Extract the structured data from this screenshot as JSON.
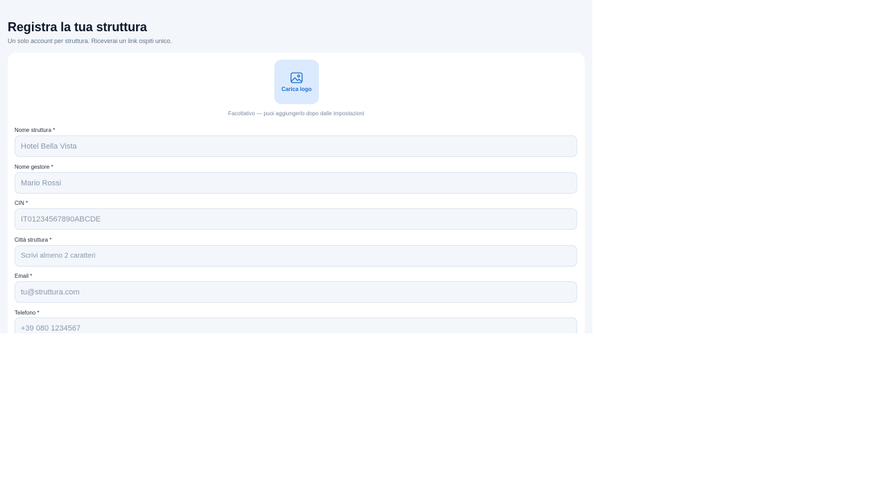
{
  "header": {
    "title": "Registra la tua struttura",
    "subtitle": "Un solo account per struttura. Riceverai un link ospiti unico."
  },
  "logo": {
    "icon": "image-icon",
    "label": "Carica logo",
    "hint": "Facoltativo — puoi aggiungerlo dopo dalle impostazioni"
  },
  "form": {
    "fields": [
      {
        "label": "Nome struttura *",
        "placeholder": "Hotel Bella Vista",
        "value": ""
      },
      {
        "label": "Nome gestore *",
        "placeholder": "Mario Rossi",
        "value": ""
      },
      {
        "label": "CIN *",
        "placeholder": "IT01234567890ABCDE",
        "value": ""
      },
      {
        "label": "Città struttura *",
        "placeholder": "Scrivi almeno 2 caratteri",
        "value": ""
      },
      {
        "label": "Email *",
        "placeholder": "tu@struttura.com",
        "value": ""
      },
      {
        "label": "Telefono *",
        "placeholder": "+39 080 1234567",
        "value": ""
      }
    ]
  },
  "colors": {
    "background": "#f3f7fc",
    "card": "#ffffff",
    "accent": "#1d6fd1",
    "accent_soft": "#dbeafe",
    "title": "#0f172a"
  }
}
